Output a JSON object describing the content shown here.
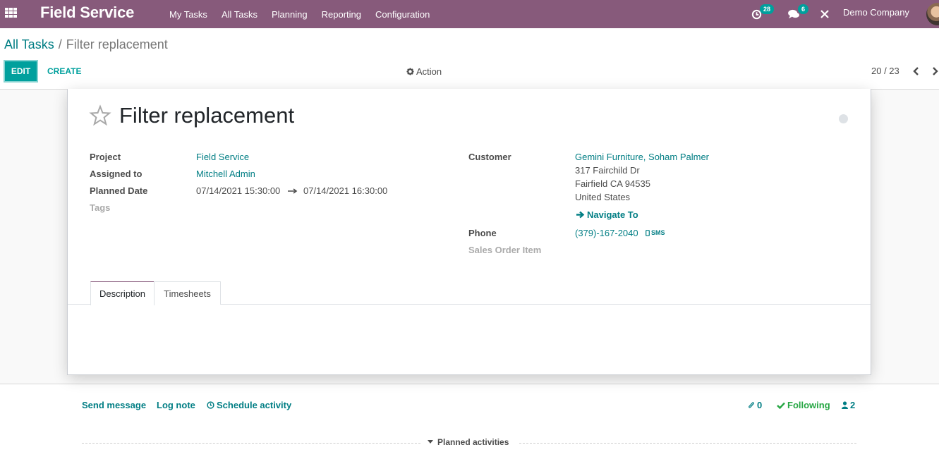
{
  "navbar": {
    "app_name": "Field Service",
    "menu": [
      "My Tasks",
      "All Tasks",
      "Planning",
      "Reporting",
      "Configuration"
    ],
    "activity_count": "28",
    "message_count": "6",
    "company": "Demo Company"
  },
  "breadcrumb": {
    "parent": "All Tasks",
    "separator": "/",
    "current": "Filter replacement"
  },
  "toolbar": {
    "edit_label": "EDIT",
    "create_label": "CREATE",
    "action_label": "Action",
    "pager": "20 / 23"
  },
  "record": {
    "title": "Filter replacement",
    "left_fields": [
      {
        "label": "Project",
        "value": "Field Service"
      },
      {
        "label": "Assigned to",
        "value": "Mitchell Admin"
      },
      {
        "label": "Planned Date",
        "start": "07/14/2021 15:30:00",
        "end": "07/14/2021 16:30:00"
      },
      {
        "label": "Tags",
        "value": ""
      }
    ],
    "customer": {
      "label": "Customer",
      "name": "Gemini Furniture, Soham Palmer",
      "street": "317 Fairchild Dr",
      "city_line": "Fairfield CA 94535",
      "country": "United States",
      "navigate_label": "Navigate To"
    },
    "phone": {
      "label": "Phone",
      "value": "(379)-167-2040",
      "sms_label": "SMS"
    },
    "sales_order_item": {
      "label": "Sales Order Item",
      "value": ""
    }
  },
  "tabs": [
    "Description",
    "Timesheets"
  ],
  "chatter": {
    "send_message": "Send message",
    "log_note": "Log note",
    "schedule_activity": "Schedule activity",
    "attachments": "0",
    "following": "Following",
    "followers": "2",
    "planned_activities": "Planned activities"
  },
  "colors": {
    "brand": "#875a7b",
    "accent": "#00a09d",
    "link": "#017e84",
    "following": "#28a745"
  }
}
